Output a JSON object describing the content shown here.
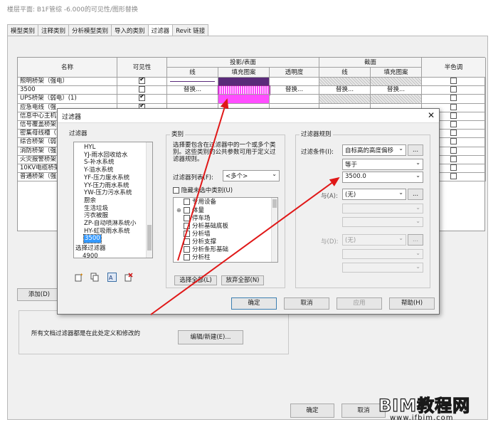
{
  "window": {
    "title": "楼层平面: B1F管综 -6.000的可见性/图形替换"
  },
  "tabs": [
    {
      "label": "模型类别"
    },
    {
      "label": "注释类别"
    },
    {
      "label": "分析模型类别"
    },
    {
      "label": "导入的类别"
    },
    {
      "label": "过滤器"
    },
    {
      "label": "Revit 链接"
    }
  ],
  "grid": {
    "headers": {
      "name": "名称",
      "visibility": "可见性",
      "projection": "投影/表面",
      "cut": "截面",
      "halftone": "半色调",
      "line": "线",
      "fill": "填充图案",
      "transparency": "透明度",
      "cut_line": "线",
      "cut_fill": "填充图案"
    },
    "rows": [
      {
        "name": "照明桥架（强电）",
        "visible": true
      },
      {
        "name": "3500",
        "visible": false
      },
      {
        "name": "UPS桥架（弱电）(1)",
        "visible": true
      },
      {
        "name": "应急电线（强",
        "visible": true
      },
      {
        "name": "信息中心主机",
        "visible": true
      },
      {
        "name": "信号覆盖桥架",
        "visible": true
      },
      {
        "name": "密集母线槽（",
        "visible": true
      },
      {
        "name": "综合桥架（弱",
        "visible": true
      },
      {
        "name": "消防桥架（强",
        "visible": true
      },
      {
        "name": "火灾报警桥架",
        "visible": true
      },
      {
        "name": "10KV电缆桥架",
        "visible": true
      },
      {
        "name": "普通桥架（强",
        "visible": true
      }
    ],
    "override_label": "替换...",
    "colors": {
      "fill_purple": "#5a2a7a",
      "fill_magenta": "#ff4dff",
      "hatch_gray": "#b0b0b0"
    }
  },
  "below": {
    "add_button": "添加(D)",
    "note": "所有文档过滤器都是在此处定义和修改的",
    "edit_new_button": "编辑/新建(E)..."
  },
  "footer": {
    "ok": "确定",
    "cancel": "取消"
  },
  "dialog": {
    "title": "过滤器",
    "filters_group": "过滤器",
    "filters_list": [
      "HYL",
      "YJ-雨水回收给水",
      "S-补水系统",
      "Y-溢水系统",
      "YF-压力废水系统",
      "YY-压力雨水系统",
      "YW-压力污水系统",
      "厨余",
      "生活垃圾",
      "污衣被服",
      "ZP-自动喷淋系统小",
      "HY-虹吸雨水系统",
      "3500",
      "选择过滤器",
      "4900"
    ],
    "selected_filter": "3500",
    "categories_group": "类别",
    "categories_desc": "选择要包含在过滤器中的一个或多个类别。这些类别的公共参数可用于定义过滤器规则。",
    "filter_list_label": "过滤器列表(F):",
    "filter_list_value": "<多个>",
    "hide_unchecked_label": "隐藏未选中类别(U)",
    "categories": [
      "专用设备",
      "体量",
      "停车场",
      "分析基础底板",
      "分析墙",
      "分析支撑",
      "分析条形基础",
      "分析柱"
    ],
    "select_all": "选择全部(L)",
    "select_none": "放弃全部(N)",
    "rules_group": "过滤器规则",
    "condition_label": "过滤条件(I):",
    "condition_param": "自标高的高度偏移",
    "operator": "等于",
    "value": "3500.0",
    "and_label_1": "与(A):",
    "and_label_2": "与(D):",
    "none_value": "(无)",
    "more_label": "...",
    "ok": "确定",
    "cancel": "取消",
    "apply": "应用",
    "help": "帮助(H)",
    "close_glyph": "✕"
  },
  "watermark": {
    "logo": "BIM教程网",
    "url": "www.ifbim.com"
  }
}
